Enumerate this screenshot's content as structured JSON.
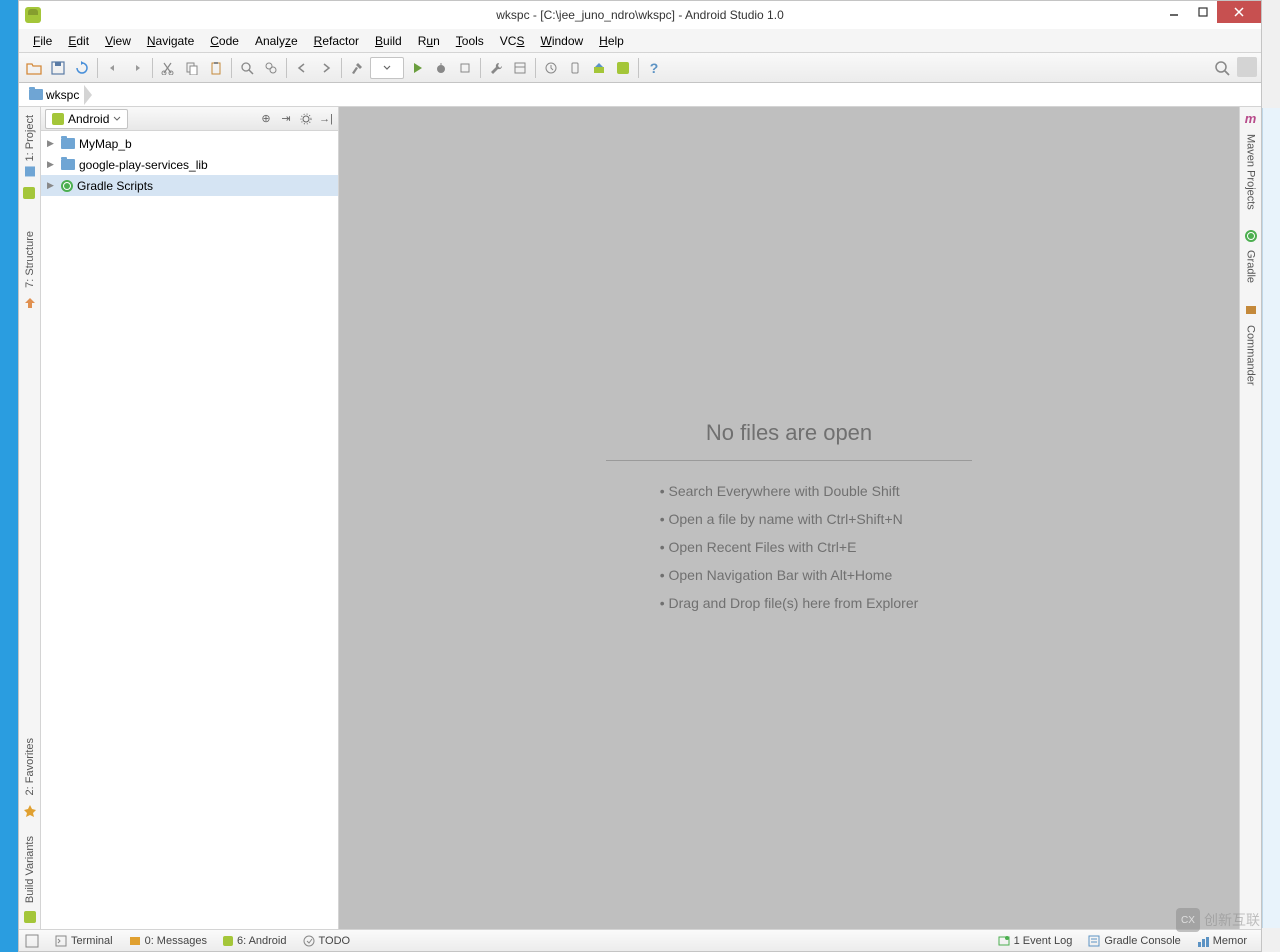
{
  "titlebar": {
    "title": "wkspc - [C:\\jee_juno_ndro\\wkspc] - Android Studio 1.0"
  },
  "menu": [
    "File",
    "Edit",
    "View",
    "Navigate",
    "Code",
    "Analyze",
    "Refactor",
    "Build",
    "Run",
    "Tools",
    "VCS",
    "Window",
    "Help"
  ],
  "breadcrumb": {
    "item": "wkspc"
  },
  "project_panel": {
    "dropdown_label": "Android",
    "tree": [
      {
        "label": "MyMap_b",
        "icon": "folder"
      },
      {
        "label": "google-play-services_lib",
        "icon": "folder"
      },
      {
        "label": "Gradle Scripts",
        "icon": "gradle"
      }
    ]
  },
  "left_gutter": {
    "project": "1: Project",
    "structure": "7: Structure",
    "favorites": "2: Favorites",
    "build_variants": "Build Variants"
  },
  "right_gutter": {
    "maven": "Maven Projects",
    "gradle": "Gradle",
    "commander": "Commander"
  },
  "editor": {
    "heading": "No files are open",
    "tips": [
      "• Search Everywhere with Double Shift",
      "• Open a file by name with Ctrl+Shift+N",
      "• Open Recent Files with Ctrl+E",
      "• Open Navigation Bar with Alt+Home",
      "• Drag and Drop file(s) here from Explorer"
    ]
  },
  "statusbar": {
    "terminal": "Terminal",
    "messages": "0: Messages",
    "android": "6: Android",
    "todo": "TODO",
    "event_log": "1  Event Log",
    "gradle_console": "Gradle Console",
    "memory": "Memor"
  },
  "watermark": "创新互联"
}
